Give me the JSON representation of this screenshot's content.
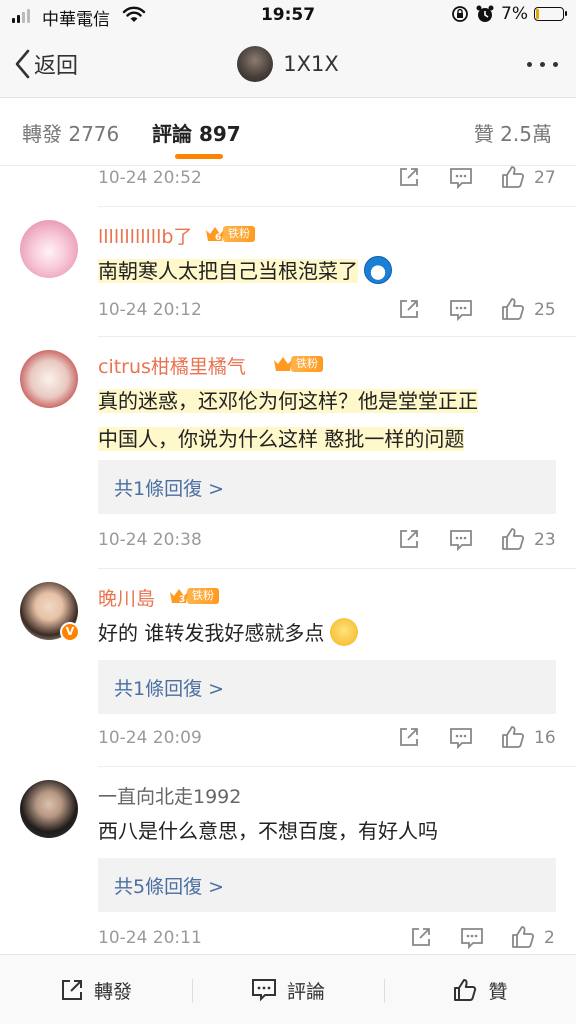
{
  "status_bar": {
    "carrier": "中華電信",
    "time": "19:57",
    "battery": "7%",
    "battery_level": 0.07
  },
  "nav": {
    "back_label": "返回",
    "title": "1X1X"
  },
  "tabs": [
    {
      "label": "轉發 2776"
    },
    {
      "label": "評論 897"
    },
    {
      "label": "贊 2.5萬"
    }
  ],
  "top_fragment": {
    "time": "10-24 20:52",
    "likes": "27"
  },
  "comments": [
    {
      "user": "llllllllllllb了",
      "fan_badge": {
        "level": "6",
        "label": "铁粉"
      },
      "lines": [
        "南朝寒人太把自己当根泡菜了"
      ],
      "emoji": "doraemon-emoji",
      "time": "10-24 20:12",
      "likes": "25"
    },
    {
      "user": "citrus柑橘里橘气",
      "fan_badge": {
        "level": "",
        "label": "铁粉"
      },
      "lines": [
        "真的迷惑，还邓伦为何这样？他是堂堂正正",
        "中国人，你说为什么这样   憨批一样的问题"
      ],
      "reply_link": "共1條回復 >",
      "time": "10-24 20:38",
      "likes": "23"
    },
    {
      "user": "晚川島",
      "fan_badge": {
        "level": "3",
        "label": "铁粉"
      },
      "verified": "V",
      "lines": [
        "好的 谁转发我好感就多点"
      ],
      "emoji": "kiss-emoji",
      "reply_link": "共1條回復 >",
      "time": "10-24 20:09",
      "likes": "16"
    },
    {
      "user": "一直向北走1992",
      "lines": [
        "西八是什么意思，不想百度，有好人吗"
      ],
      "reply_link": "共5條回復 >",
      "time": "10-24 20:11",
      "likes": "2"
    }
  ],
  "bottom_bar": {
    "repost": "轉發",
    "comment": "評論",
    "like": "贊"
  },
  "colors": {
    "accent": "#ff8200",
    "username": "#eb7350",
    "reply_link": "#4a6fa0"
  }
}
